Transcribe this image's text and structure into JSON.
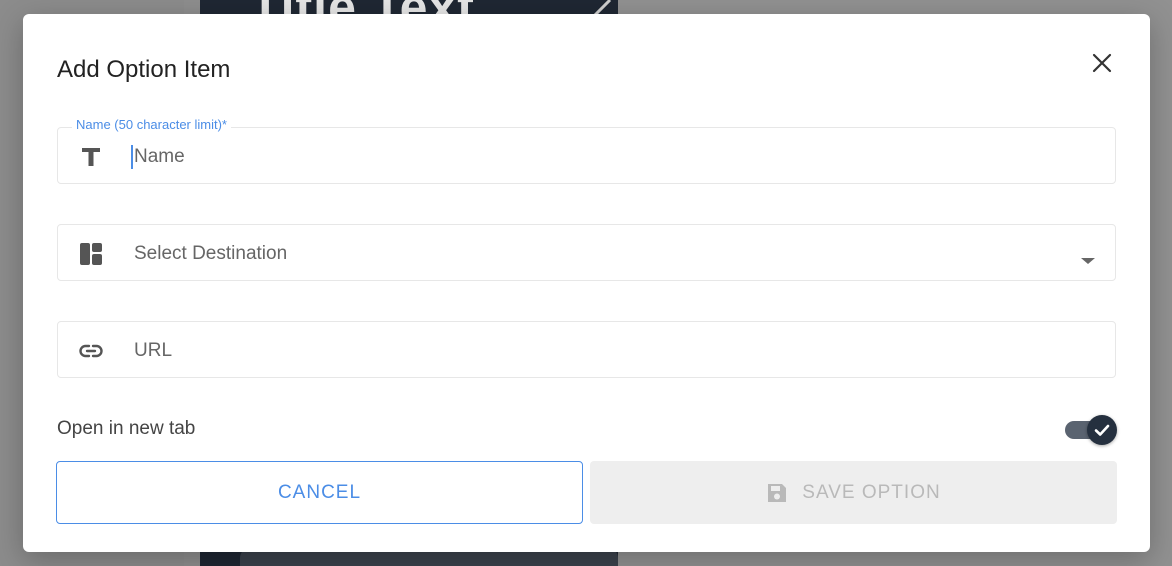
{
  "background": {
    "title_text": "Title Text"
  },
  "dialog": {
    "title": "Add Option Item",
    "close_icon": "close-icon"
  },
  "form": {
    "name": {
      "label": "Name (50 character limit)*",
      "placeholder": "Name",
      "value": "",
      "icon": "text-format-icon"
    },
    "destination": {
      "selected": "Select Destination",
      "icon": "layout-icon"
    },
    "url": {
      "placeholder": "URL",
      "value": "",
      "icon": "link-icon"
    },
    "open_new_tab": {
      "label": "Open in new tab",
      "checked": true
    }
  },
  "actions": {
    "cancel_label": "CANCEL",
    "save_label": "SAVE OPTION",
    "save_icon": "floppy-disk-icon"
  },
  "colors": {
    "accent": "#4b8de6",
    "toggle": "#25303f",
    "disabled": "#b9b9b9"
  }
}
